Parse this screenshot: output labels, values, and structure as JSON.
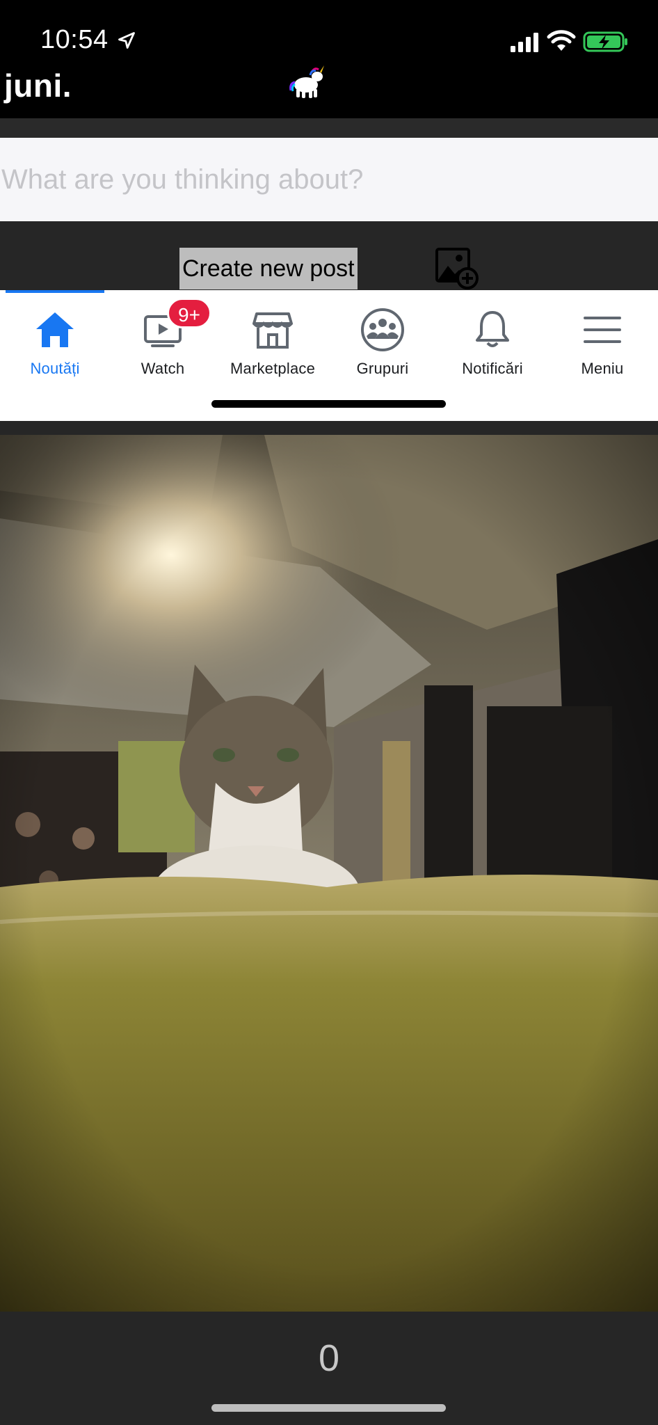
{
  "status_bar": {
    "time": "10:54",
    "icons": [
      "location-arrow-icon",
      "cellular-signal-icon",
      "wifi-icon",
      "battery-charging-icon"
    ]
  },
  "header": {
    "title": "juni.",
    "logo_icon": "unicorn-logo"
  },
  "composer": {
    "placeholder": "What are you thinking about?",
    "create_post_label": "Create new post",
    "add_photo_icon": "add-photo-icon"
  },
  "tab_nav": {
    "active_index": 0,
    "active_color": "#1877f2",
    "tabs": [
      {
        "label": "Noutăți",
        "icon": "home-icon"
      },
      {
        "label": "Watch",
        "icon": "video-play-icon",
        "badge": "9+"
      },
      {
        "label": "Marketplace",
        "icon": "shop-icon"
      },
      {
        "label": "Grupuri",
        "icon": "groups-icon"
      },
      {
        "label": "Notificări",
        "icon": "bell-icon"
      },
      {
        "label": "Meniu",
        "icon": "menu-icon"
      }
    ]
  },
  "post": {
    "image_subject": "cat-photo",
    "count": "0"
  },
  "colors": {
    "badge": "#e41e3f",
    "battery": "#34c759"
  }
}
